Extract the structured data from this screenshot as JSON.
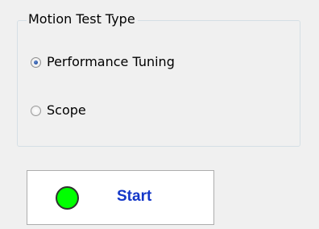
{
  "motion_test": {
    "group_title": "Motion Test Type",
    "options": [
      {
        "label": "Performance Tuning",
        "selected": true
      },
      {
        "label": "Scope",
        "selected": false
      }
    ]
  },
  "start_button": {
    "label": "Start",
    "status_indicator": "green-led-icon",
    "status_color": "#00ff00",
    "label_color": "#1437c8"
  }
}
